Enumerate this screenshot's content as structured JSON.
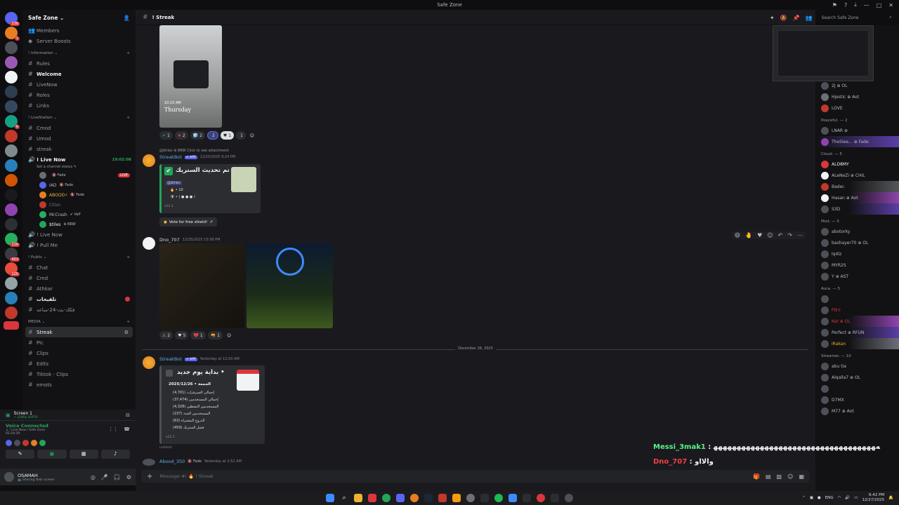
{
  "window": {
    "title": "Safe Zone"
  },
  "server": {
    "name": "Safe Zone ⌄"
  },
  "sidebar": {
    "top_items": [
      {
        "label": "Members"
      },
      {
        "label": "Server Boosts"
      }
    ],
    "categories": [
      {
        "label": "! Information ⌄",
        "channels": [
          "Rules",
          "Welcome",
          "LiveNow",
          "Roles",
          "Links"
        ]
      },
      {
        "label": "! LiveStation ⌄",
        "channels": [
          "Cmod",
          "Umod",
          "streak"
        ]
      }
    ],
    "voice_channel": {
      "name": "! Live Now",
      "timer": "19:02:08",
      "status": "Set a channel status ✎"
    },
    "voice_users": [
      {
        "name": "",
        "tag": "🔇 Fade",
        "live": "LIVE"
      },
      {
        "name": "IAD",
        "tag": "🔇 Fade"
      },
      {
        "name": "ABOOD⚡",
        "tag": "🔇 Fade"
      },
      {
        "name": "Clilan",
        "tag": ""
      },
      {
        "name": "McCrash",
        "tag": "✔ VaP"
      },
      {
        "name": "$tiles",
        "tag": "⊕ BRW"
      }
    ],
    "voice2": [
      "! Live Now",
      "! Pull Me"
    ],
    "public_cat": "! Public ⌄",
    "public_channels": [
      "Chat",
      "Cmd",
      "Athkar",
      "تلقيحات",
      "فكك-بث-24-ساعه"
    ],
    "media_cat": "MEDIA ⌄",
    "media_channels": [
      "Streak",
      "Pic",
      "Clips",
      "Edits",
      "Tiktok - Clips",
      "emots"
    ]
  },
  "voice_panel": {
    "screen": "Screen 1",
    "screen_sub": "⚡ 1080p 60FPS",
    "connected": "Voice Connected",
    "location": "↳ ! Live Now / Safe Zone",
    "timer": "02:24:39"
  },
  "user": {
    "name": "OSAMAH",
    "status": "📺 Sharing their screen"
  },
  "channel": {
    "name": "! Streak"
  },
  "search": {
    "placeholder": "Search Safe Zone"
  },
  "messages": {
    "image1_caption_time": "10:10 AM",
    "image1_caption_day": "Thursday",
    "reactions1": [
      {
        "emoji": "✔",
        "count": "1",
        "color": "#23a55a"
      },
      {
        "emoji": "✖",
        "count": "2",
        "color": "#da373c"
      },
      {
        "emoji": "🧊",
        "count": "2",
        "color": "#5dade2"
      },
      {
        "emoji": "",
        "count": "2",
        "color": "#da373c",
        "me": true
      },
      {
        "emoji": "♥",
        "count": "1",
        "color": "#ffffff"
      },
      {
        "emoji": "",
        "count": "1",
        "color": "#949ba4"
      }
    ],
    "bot1": {
      "reply": "@$tiles ⊕ BRW Click to see attachment",
      "author": "StreakBot",
      "badge": "✔ APP",
      "time": "12/25/2025 9:24 PM",
      "title": "تم تحديث الستريك •",
      "mention": "@$tiles",
      "line1": "🔥 • 10",
      "line2": "🛡 • ( ● ● ● )",
      "footer": "v11.1",
      "button": "Vote for free shield!"
    },
    "msg2": {
      "author": "Dno_707",
      "time": "12/25/2025 10:36 PM",
      "reactions": [
        {
          "emoji": "⚠",
          "count": "2"
        },
        {
          "emoji": "♥",
          "count": "5"
        },
        {
          "emoji": "💔",
          "count": "1"
        },
        {
          "emoji": "🔫",
          "count": "1"
        }
      ]
    },
    "date_divider": "December 26, 2025",
    "bot2": {
      "author": "StreakBot",
      "badge": "✔ APP",
      "time": "Yesterday at 12:00 AM",
      "title": "بداية يوم جديد •",
      "date": "2025/12/26 • الجمعة",
      "stats": [
        "(4,701) إجمالي السيرفرات",
        "(37,474) إجمالي المستخدمين",
        "(4,328) المستخدمين النشطين",
        "(237) المستخدمين الجدد",
        "(63) الدروع المشتراة",
        "(459) فشل الستريك"
      ],
      "footer": "v11.1",
      "edited": "(edited)"
    },
    "msg3": {
      "author": "Abood_350",
      "tag": "🔇 Fade",
      "time": "Yesterday at 2:52 AM"
    }
  },
  "overlay_chat": [
    {
      "user": "Messi_3mak1",
      "text": " : ﻪﻬﻬﻬﻬﻬﻬﻬﻬﻬﻬﻬﻬﻬﻬﻬﻬﻬﻬﻬﻬﻬﻬﻬﻬﻬﻬﻬﻬﻬﻬﻬﻬﻬﻬﻬ",
      "color": "#57f287"
    },
    {
      "user": "Dno_707",
      "text": " : والااو",
      "color": "#ed4245"
    }
  ],
  "composer": {
    "placeholder": "Message #! 🔥 ! Streak"
  },
  "members": {
    "groups": [
      {
        "label": "",
        "items": [
          "2J ⊕ OL",
          "Hjestic ⊕ Aot",
          "LOVE"
        ]
      },
      {
        "label": "Peaceful. — 2",
        "items": [
          "LNAR ⊕",
          "TheSlee... ⊕ Fade"
        ]
      },
      {
        "label": "Cloud. — 5",
        "items": [
          "ALD8MY",
          "ALeNeZi ⊕ CHIL",
          "Bader.",
          "Hasan ⊕ Aot",
          "S3D"
        ]
      },
      {
        "label": "Mod. — 5",
        "items": [
          "abotorky",
          "bashayer70 ⊕ OL",
          "lq4lz",
          "MYR2S",
          "Y ⊕ AST"
        ]
      },
      {
        "label": "Aura. — 5",
        "items": [
          "",
          "Ftt!r",
          "Ket ⊕ OL",
          "Perfect ⊕ RFUN",
          "iRakan"
        ]
      },
      {
        "label": "Streamer. — 10",
        "items": [
          "abu tia",
          "Alqalla7 ⊕ OL",
          "",
          "D7MX",
          "M77 ⊕ Aot"
        ]
      }
    ]
  },
  "taskbar": {
    "lang": "ENG",
    "time": "6:42 PM",
    "date": "12/27/2025"
  }
}
